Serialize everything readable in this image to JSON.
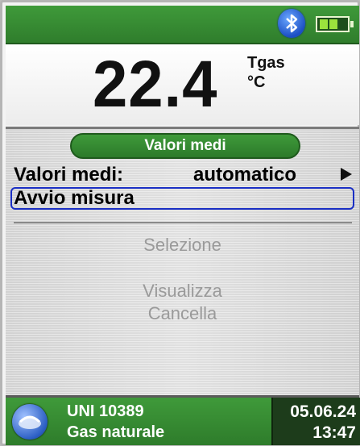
{
  "status_bar": {
    "bluetooth_icon": "bluetooth-icon",
    "battery_icon": "battery-icon",
    "battery_level": 0.66,
    "accent": "#2f7d2c"
  },
  "reading": {
    "value": "22.4",
    "parameter": "Tgas",
    "unit": "°C"
  },
  "menu": {
    "section_title": "Valori medi",
    "rows": [
      {
        "label": "Valori medi:",
        "value": "automatico"
      },
      {
        "label": "Avvio misura"
      }
    ],
    "options": [
      "Selezione",
      "Visualizza",
      "Cancella"
    ],
    "selection_color": "#1a2fc4"
  },
  "bottom_bar": {
    "fuel_icon": "flame-gas-icon",
    "standard": "UNI 10389",
    "fuel": "Gas naturale",
    "date": "05.06.24",
    "time": "13:47"
  }
}
